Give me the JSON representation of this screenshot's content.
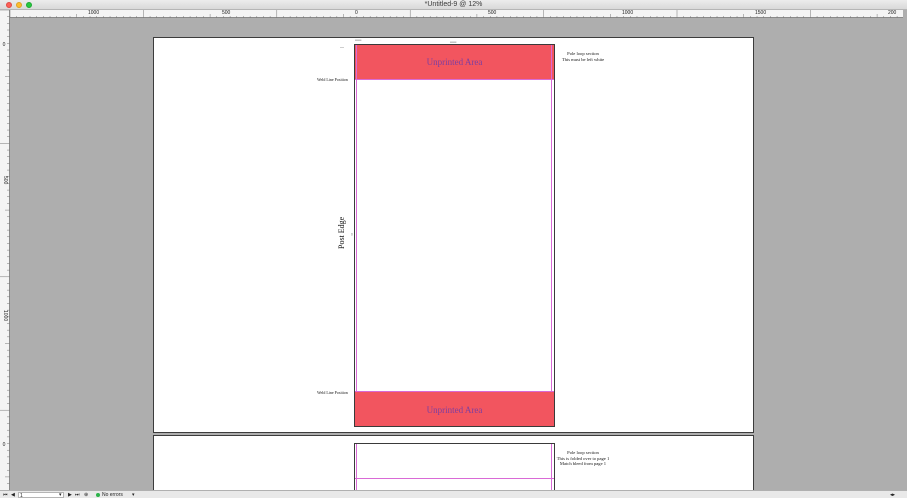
{
  "window": {
    "title": "*Untitled-9 @ 12%"
  },
  "ruler": {
    "h_labels": [
      "1000",
      "500",
      "0",
      "500",
      "1000",
      "1500",
      "200"
    ],
    "v_labels": [
      "0",
      "500",
      "1000",
      "0"
    ]
  },
  "page1": {
    "unprinted_top": "Unprinted Area",
    "unprinted_bottom": "Unprinted Area",
    "weld_top": "Weld Line Position",
    "weld_bottom": "Weld Line Position",
    "post_edge": "Post Edge",
    "pole_note_line1": "Pole loop section",
    "pole_note_line2": "This must be left white"
  },
  "page2": {
    "pole_note_line1": "Pole loop section",
    "pole_note_line2": "This is folded over to page 1",
    "pole_note_line3": "Match bleed from page 1"
  },
  "status": {
    "page_number": "1",
    "errors": "No errors"
  },
  "colors": {
    "unprinted_fill": "#f2555f",
    "unprinted_text": "#7d3fa0",
    "guide": "#d96ad6",
    "pasteboard": "#aeaeae",
    "status_ok": "#2cb34a"
  }
}
